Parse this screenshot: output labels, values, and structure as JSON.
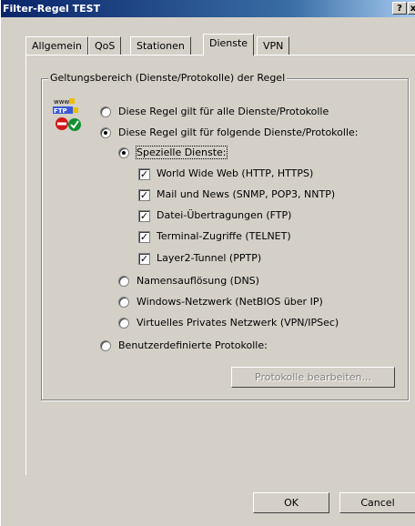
{
  "window": {
    "title": "Filter-Regel TEST",
    "help_label": "?",
    "close_label": "x"
  },
  "tabs": [
    {
      "label": "Allgemein"
    },
    {
      "label": "QoS"
    },
    {
      "label": "Stationen"
    },
    {
      "label": "Dienste"
    },
    {
      "label": "VPN"
    }
  ],
  "active_tab": "Dienste",
  "group": {
    "title": "Geltungsbereich (Dienste/Protokolle) der Regel",
    "icon": "services-ftp-www-icon"
  },
  "options": {
    "all": {
      "label": "Diese Regel gilt für alle Dienste/Protokolle",
      "selected": false
    },
    "following": {
      "label": "Diese Regel gilt für folgende Dienste/Protokolle:",
      "selected": true
    },
    "special": {
      "label": "Spezielle Dienste:",
      "selected": true
    },
    "dns": {
      "label": "Namensauflösung (DNS)",
      "selected": false
    },
    "netbios": {
      "label": "Windows-Netzwerk (NetBIOS über IP)",
      "selected": false
    },
    "vpn": {
      "label": "Virtuelles Privates Netzwerk (VPN/IPSec)",
      "selected": false
    },
    "custom": {
      "label": "Benutzerdefinierte Protokolle:",
      "selected": false
    }
  },
  "special_services": [
    {
      "label": "World Wide Web (HTTP, HTTPS)",
      "checked": true
    },
    {
      "label": "Mail und News (SNMP, POP3, NNTP)",
      "checked": true
    },
    {
      "label": "Datei-Übertragungen (FTP)",
      "checked": true
    },
    {
      "label": "Terminal-Zugriffe (TELNET)",
      "checked": true
    },
    {
      "label": "Layer2-Tunnel (PPTP)",
      "checked": true
    }
  ],
  "buttons": {
    "edit_protocols": "Protokolle bearbeiten...",
    "ok": "OK",
    "cancel": "Cancel"
  }
}
